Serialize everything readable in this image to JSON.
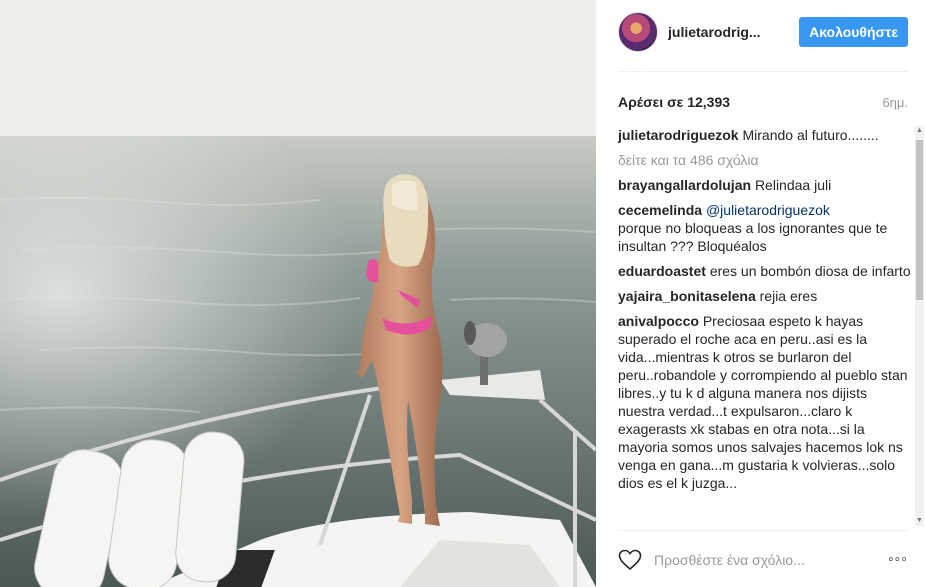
{
  "post": {
    "username": "julietarodrig...",
    "follow_label": "Ακολουθήστε",
    "likes_text": "Αρέσει σε 12,393",
    "time_ago": "6ημ.",
    "caption": {
      "user": "julietarodriguezok",
      "text": "Mirando al futuro........"
    },
    "view_all": "δείτε και τα 486 σχόλια",
    "comments": [
      {
        "user": "brayangallardolujan",
        "text": "Relindaa juli",
        "mention": ""
      },
      {
        "user": "cecemelinda",
        "mention": "@julietarodriguezok",
        "text": "porque no bloqueas a los ignorantes que te insultan ??? Bloquéalos ⁣⁣"
      },
      {
        "user": "eduardoastet",
        "text": "eres un bombón diosa de infarto",
        "mention": ""
      },
      {
        "user": "yajaira_bonitaselena",
        "text": "rejia eres",
        "mention": ""
      },
      {
        "user": "anivalpocco",
        "text": "Preciosaa espeto k hayas superado el roche aca en peru..asi es la vida...mientras k otros se burlaron del peru..robandole y corrompiendo al pueblo stan libres..y tu k d alguna manera nos dijists nuestra verdad...t expulsaron...claro k exagerasts xk stabas en otra nota...si la mayoria somos unos salvajes hacemos lok ns venga en gana...m gustaria k volvieras...solo dios es el k juzga...",
        "mention": ""
      }
    ],
    "comment_placeholder": "Προσθέστε ένα σχόλιο...",
    "more_label": "◦◦◦"
  },
  "icons": {
    "heart": "heart-icon",
    "more": "more-options-icon"
  },
  "colors": {
    "follow_button": "#3897f0",
    "mention": "#003569",
    "muted": "#999999"
  }
}
